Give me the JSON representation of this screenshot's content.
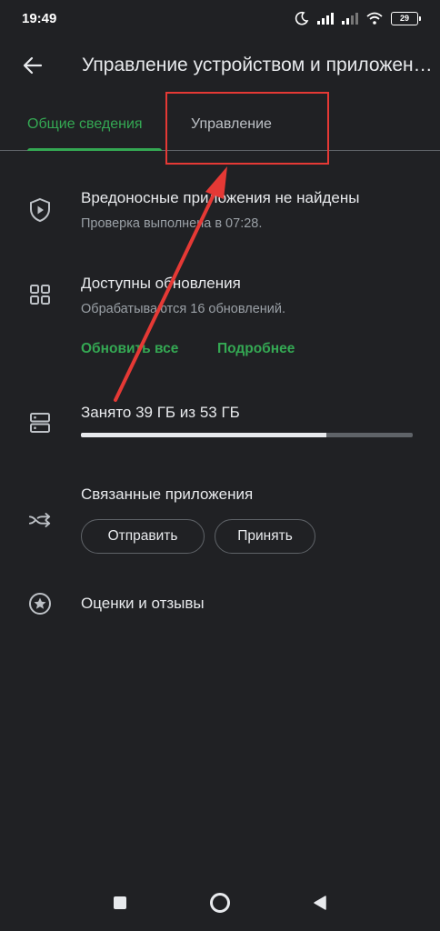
{
  "status_bar": {
    "time": "19:49",
    "battery_level": "29",
    "icons": [
      "moon-icon",
      "signal-icon",
      "signal-icon",
      "wifi-icon",
      "battery-icon"
    ]
  },
  "app_bar": {
    "title": "Управление устройством и приложениями",
    "back_icon": "arrow-left-icon"
  },
  "tabs": [
    {
      "label": "Общие сведения",
      "active": true
    },
    {
      "label": "Управление",
      "active": false
    }
  ],
  "security": {
    "icon": "shield-play-icon",
    "title": "Вредоносные приложения не найдены",
    "subtitle": "Проверка выполнена в 07:28."
  },
  "updates": {
    "icon": "apps-grid-icon",
    "title": "Доступны обновления",
    "subtitle": "Обрабатываются 16 обновлений.",
    "update_all_label": "Обновить все",
    "details_label": "Подробнее"
  },
  "storage": {
    "icon": "storage-icon",
    "title": "Занято 39 ГБ из 53 ГБ",
    "used_fraction": 0.74
  },
  "shared_apps": {
    "icon": "share-arrows-icon",
    "title": "Связанные приложения",
    "send_label": "Отправить",
    "receive_label": "Принять"
  },
  "ratings": {
    "icon": "star-circle-icon",
    "title": "Оценки и отзывы"
  },
  "annotation": {
    "color": "#e53935"
  },
  "colors": {
    "accent": "#34a853",
    "background": "#202124"
  },
  "nav_bar": [
    "square-icon",
    "circle-icon",
    "triangle-back-icon"
  ]
}
